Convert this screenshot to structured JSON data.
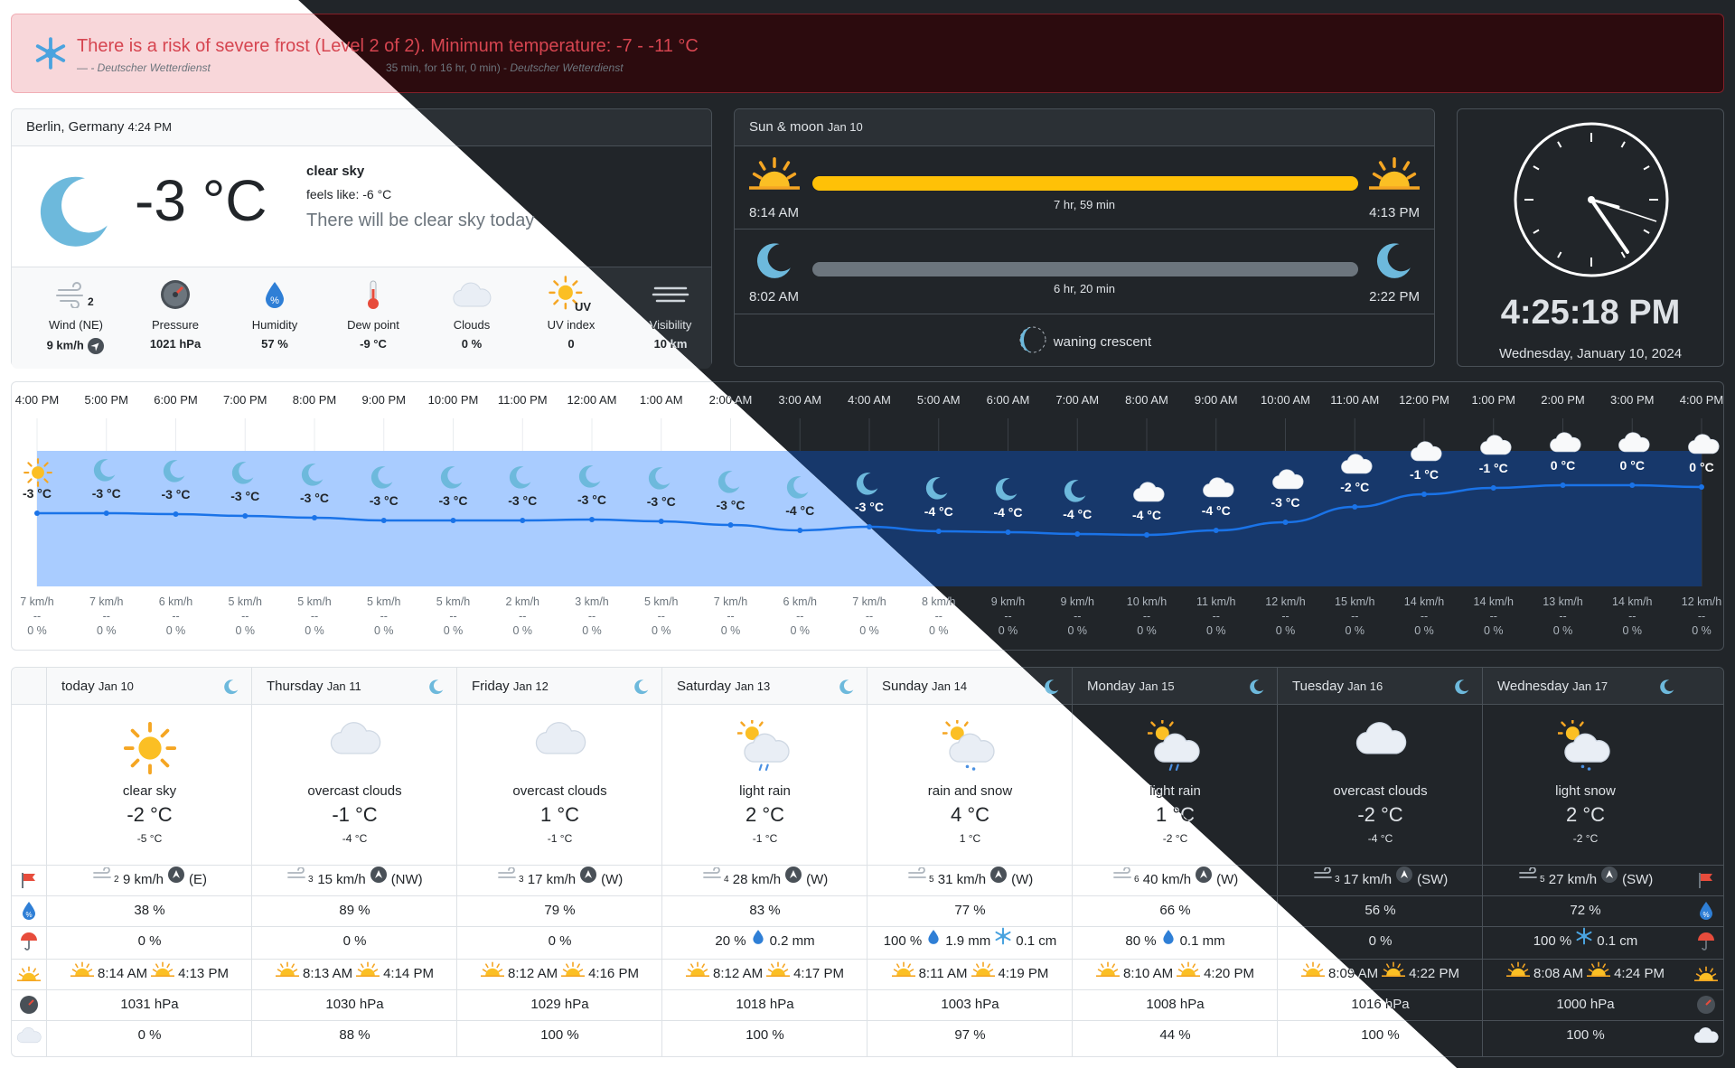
{
  "alert": {
    "title": "There is a risk of severe frost (Level 2 of 2). Minimum temperature: -7 - -11 °C",
    "subtitle_prefix": "— ",
    "subtitle_detail": "35 min, for 16 hr, 0 min) - ",
    "source": "- Deutscher Wetterdienst",
    "source2": "Deutscher Wetterdienst",
    "icon": "snowflake-icon"
  },
  "current": {
    "location": "Berlin, Germany",
    "time": "4:24 PM",
    "temp": "-3 °C",
    "description": "clear sky",
    "feels_like": "feels like: -6 °C",
    "summary": "There will be clear sky today",
    "metrics": [
      {
        "label": "Wind (NE)",
        "value": "9 km/h",
        "icon": "wind-icon",
        "extra": "2"
      },
      {
        "label": "Pressure",
        "value": "1021 hPa",
        "icon": "gauge-icon"
      },
      {
        "label": "Humidity",
        "value": "57 %",
        "icon": "humidity-icon"
      },
      {
        "label": "Dew point",
        "value": "-9 °C",
        "icon": "thermometer-icon"
      },
      {
        "label": "Clouds",
        "value": "0 %",
        "icon": "cloud-icon"
      },
      {
        "label": "UV index",
        "value": "0",
        "icon": "uv-icon"
      },
      {
        "label": "Visibility",
        "value": "10 km",
        "icon": "fog-icon"
      }
    ]
  },
  "sunmoon": {
    "title": "Sun & moon",
    "date": "Jan 10",
    "sunrise": "8:14 AM",
    "sunset": "4:13 PM",
    "sun_duration": "7 hr, 59 min",
    "moonrise": "8:02 AM",
    "moonset": "2:22 PM",
    "moon_duration": "6 hr, 20 min",
    "phase": "waning crescent"
  },
  "clock": {
    "time": "4:25:18 PM",
    "date": "Wednesday, January 10, 2024"
  },
  "hourly": {
    "hours": [
      "4:00 PM",
      "5:00 PM",
      "6:00 PM",
      "7:00 PM",
      "8:00 PM",
      "9:00 PM",
      "10:00 PM",
      "11:00 PM",
      "12:00 AM",
      "1:00 AM",
      "2:00 AM",
      "3:00 AM",
      "4:00 AM",
      "5:00 AM",
      "6:00 AM",
      "7:00 AM",
      "8:00 AM",
      "9:00 AM",
      "10:00 AM",
      "11:00 AM",
      "12:00 PM",
      "1:00 PM",
      "2:00 PM",
      "3:00 PM",
      "4:00 PM"
    ],
    "temps": [
      -3,
      -3,
      -3,
      -3,
      -3,
      -3,
      -3,
      -3,
      -3,
      -3,
      -3,
      -4,
      -3,
      -4,
      -4,
      -4,
      -4,
      -4,
      -3,
      -2,
      -1,
      -1,
      0,
      0,
      0
    ],
    "temp_labels": [
      "-3 °C",
      "-3 °C",
      "-3 °C",
      "-3 °C",
      "-3 °C",
      "-3 °C",
      "-3 °C",
      "-3 °C",
      "-3 °C",
      "-3 °C",
      "-3 °C",
      "-4 °C",
      "-3 °C",
      "-4 °C",
      "-4 °C",
      "-4 °C",
      "-4 °C",
      "-4 °C",
      "-3 °C",
      "-2 °C",
      "-1 °C",
      "-1 °C",
      "0 °C",
      "0 °C",
      "0 °C"
    ],
    "icons": [
      "sun-icon",
      "moon-icon",
      "moon-icon",
      "moon-icon",
      "moon-icon",
      "moon-icon",
      "moon-icon",
      "moon-icon",
      "moon-icon",
      "moon-icon",
      "moon-icon",
      "moon-icon",
      "moon-icon",
      "moon-icon",
      "moon-icon",
      "moon-icon",
      "cloud-icon",
      "cloud-icon",
      "cloud-icon",
      "cloud-icon",
      "cloud-icon",
      "cloud-icon",
      "cloud-icon",
      "cloud-icon",
      "cloud-icon"
    ],
    "winds": [
      "7 km/h",
      "7 km/h",
      "6 km/h",
      "5 km/h",
      "5 km/h",
      "5 km/h",
      "5 km/h",
      "2 km/h",
      "3 km/h",
      "5 km/h",
      "7 km/h",
      "6 km/h",
      "7 km/h",
      "8 km/h",
      "9 km/h",
      "9 km/h",
      "10 km/h",
      "11 km/h",
      "12 km/h",
      "15 km/h",
      "14 km/h",
      "14 km/h",
      "13 km/h",
      "14 km/h",
      "12 km/h"
    ],
    "precip": [
      "--",
      "--",
      "--",
      "--",
      "--",
      "--",
      "--",
      "--",
      "--",
      "--",
      "--",
      "--",
      "--",
      "--",
      "--",
      "--",
      "--",
      "--",
      "--",
      "--",
      "--",
      "--",
      "--",
      "--",
      "--"
    ],
    "pop": [
      "0 %",
      "0 %",
      "0 %",
      "0 %",
      "0 %",
      "0 %",
      "0 %",
      "0 %",
      "0 %",
      "0 %",
      "0 %",
      "0 %",
      "0 %",
      "0 %",
      "0 %",
      "0 %",
      "0 %",
      "0 %",
      "0 %",
      "0 %",
      "0 %",
      "0 %",
      "0 %",
      "0 %",
      "0 %"
    ]
  },
  "daily": [
    {
      "day": "today",
      "date": "Jan 10",
      "icon": "sun-icon",
      "desc": "clear sky",
      "temp": "-2 °C",
      "feels": "-5 °C",
      "wind": "9 km/h",
      "wind_dir": "(E)",
      "beaufort": "2",
      "humidity": "38 %",
      "rain_pop": "0 %",
      "rain_amt": "",
      "snow_amt": "",
      "sunrise": "8:14 AM",
      "sunset": "4:13 PM",
      "pressure": "1031 hPa",
      "clouds": "0 %"
    },
    {
      "day": "Thursday",
      "date": "Jan 11",
      "icon": "cloud-icon",
      "desc": "overcast clouds",
      "temp": "-1 °C",
      "feels": "-4 °C",
      "wind": "15 km/h",
      "wind_dir": "(NW)",
      "beaufort": "3",
      "humidity": "89 %",
      "rain_pop": "0 %",
      "rain_amt": "",
      "snow_amt": "",
      "sunrise": "8:13 AM",
      "sunset": "4:14 PM",
      "pressure": "1030 hPa",
      "clouds": "88 %"
    },
    {
      "day": "Friday",
      "date": "Jan 12",
      "icon": "cloud-icon",
      "desc": "overcast clouds",
      "temp": "1 °C",
      "feels": "-1 °C",
      "wind": "17 km/h",
      "wind_dir": "(W)",
      "beaufort": "3",
      "humidity": "79 %",
      "rain_pop": "0 %",
      "rain_amt": "",
      "snow_amt": "",
      "sunrise": "8:12 AM",
      "sunset": "4:16 PM",
      "pressure": "1029 hPa",
      "clouds": "100 %"
    },
    {
      "day": "Saturday",
      "date": "Jan 13",
      "icon": "rain-icon",
      "desc": "light rain",
      "temp": "2 °C",
      "feels": "-1 °C",
      "wind": "28 km/h",
      "wind_dir": "(W)",
      "beaufort": "4",
      "humidity": "83 %",
      "rain_pop": "20 %",
      "rain_amt": "0.2 mm",
      "snow_amt": "",
      "sunrise": "8:12 AM",
      "sunset": "4:17 PM",
      "pressure": "1018 hPa",
      "clouds": "100 %"
    },
    {
      "day": "Sunday",
      "date": "Jan 14",
      "icon": "snow-icon",
      "desc": "rain and snow",
      "temp": "4 °C",
      "feels": "1 °C",
      "wind": "31 km/h",
      "wind_dir": "(W)",
      "beaufort": "5",
      "humidity": "77 %",
      "rain_pop": "100 %",
      "rain_amt": "1.9 mm",
      "snow_amt": "0.1 cm",
      "sunrise": "8:11 AM",
      "sunset": "4:19 PM",
      "pressure": "1003 hPa",
      "clouds": "97 %"
    },
    {
      "day": "Monday",
      "date": "Jan 15",
      "icon": "rain-icon",
      "desc": "light rain",
      "temp": "1 °C",
      "feels": "-2 °C",
      "wind": "40 km/h",
      "wind_dir": "(W)",
      "beaufort": "6",
      "humidity": "66 %",
      "rain_pop": "80 %",
      "rain_amt": "0.1 mm",
      "snow_amt": "",
      "sunrise": "8:10 AM",
      "sunset": "4:20 PM",
      "pressure": "1008 hPa",
      "clouds": "44 %"
    },
    {
      "day": "Tuesday",
      "date": "Jan 16",
      "icon": "cloud-icon",
      "desc": "overcast clouds",
      "temp": "-2 °C",
      "feels": "-4 °C",
      "wind": "17 km/h",
      "wind_dir": "(SW)",
      "beaufort": "3",
      "humidity": "56 %",
      "rain_pop": "0 %",
      "rain_amt": "",
      "snow_amt": "",
      "sunrise": "8:09 AM",
      "sunset": "4:22 PM",
      "pressure": "1016 hPa",
      "clouds": "100 %"
    },
    {
      "day": "Wednesday",
      "date": "Jan 17",
      "icon": "snow-icon",
      "desc": "light snow",
      "temp": "2 °C",
      "feels": "-2 °C",
      "wind": "27 km/h",
      "wind_dir": "(SW)",
      "beaufort": "5",
      "humidity": "72 %",
      "rain_pop": "100 %",
      "rain_amt": "",
      "snow_amt": "0.1 cm",
      "sunrise": "8:08 AM",
      "sunset": "4:24 PM",
      "pressure": "1000 hPa",
      "clouds": "100 %"
    }
  ],
  "colors": {
    "accent": "#0d6efd",
    "sun_bar": "#ffc107",
    "moon_bar": "#6c757d",
    "alert_text": "#d64550"
  }
}
